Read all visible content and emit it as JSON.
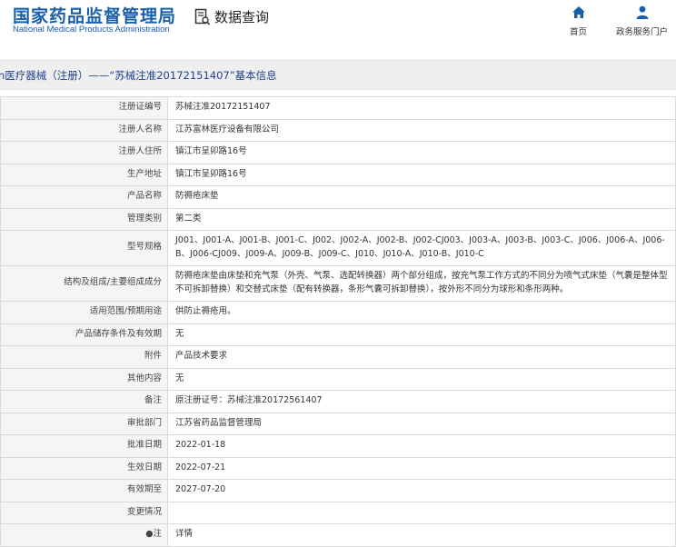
{
  "header": {
    "logo_cn": "国家药品监督管理局",
    "logo_en": "National Medical Products Administration",
    "section": "数据查询",
    "nav_home": "首页",
    "nav_portal": "政务服务门户"
  },
  "breadcrumb": "n医疗器械（注册）——“苏械注准20172151407”基本信息",
  "rows": [
    {
      "label": "注册证编号",
      "value": "苏械注准20172151407"
    },
    {
      "label": "注册人名称",
      "value": "江苏富林医疗设备有限公司"
    },
    {
      "label": "注册人住所",
      "value": "镇江市呈卯路16号"
    },
    {
      "label": "生产地址",
      "value": "镇江市呈卯路16号"
    },
    {
      "label": "产品名称",
      "value": "防褥疮床垫"
    },
    {
      "label": "管理类别",
      "value": "第二类"
    },
    {
      "label": "型号规格",
      "value": "J001、J001-A、J001-B、J001-C、J002、J002-A、J002-B、J002-CJ003、J003-A、J003-B、J003-C、J006、J006-A、J006-B、J006-CJ009、J009-A、J009-B、J009-C、J010、J010-A、J010-B、J010-C"
    },
    {
      "label": "结构及组成/主要组成成分",
      "value": "防褥疮床垫由床垫和充气泵（外壳、气泵、选配转换器）两个部分组成，按充气泵工作方式的不同分为喷气式床垫（气囊是整体型不可拆卸替换）和交替式床垫（配有转换器，条形气囊可拆卸替换），按外形不同分为球形和条形两种。"
    },
    {
      "label": "适用范围/预期用途",
      "value": "供防止褥疮用。"
    },
    {
      "label": "产品储存条件及有效期",
      "value": "无"
    },
    {
      "label": "附件",
      "value": "产品技术要求"
    },
    {
      "label": "其他内容",
      "value": "无"
    },
    {
      "label": "备注",
      "value": "原注册证号：苏械注准20172561407"
    },
    {
      "label": "审批部门",
      "value": "江苏省药品监督管理局"
    },
    {
      "label": "批准日期",
      "value": "2022-01-18"
    },
    {
      "label": "生效日期",
      "value": "2022-07-21"
    },
    {
      "label": "有效期至",
      "value": "2027-07-20"
    },
    {
      "label": "变更情况",
      "value": ""
    },
    {
      "label": "●注",
      "value": "详情"
    }
  ]
}
